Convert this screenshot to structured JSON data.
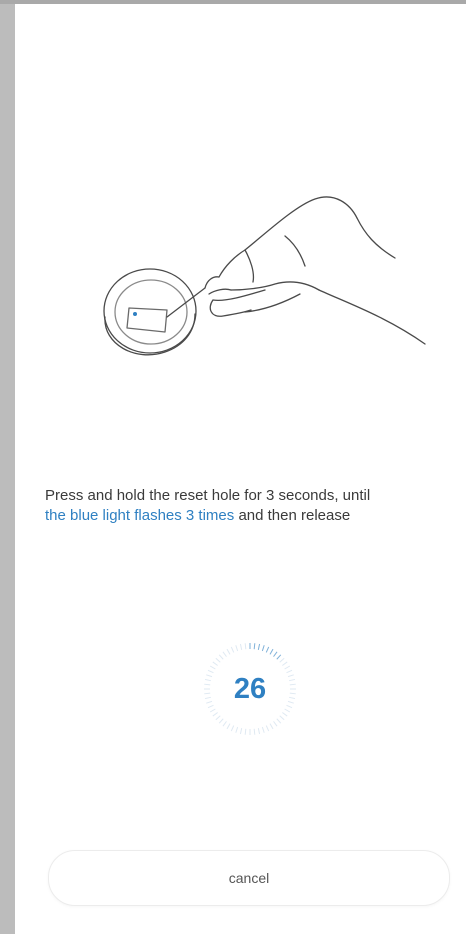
{
  "instruction": {
    "line1": "Press and hold the reset hole for 3 seconds, until",
    "highlight": "the blue light flashes 3 times",
    "line2_rest": " and then release"
  },
  "countdown": {
    "value": "26"
  },
  "cancel_label": "cancel",
  "colors": {
    "accent": "#2f80c2",
    "text": "#3a3a3a"
  },
  "icons": {
    "illustration": "hand-pressing-reset-hole-illustration"
  }
}
